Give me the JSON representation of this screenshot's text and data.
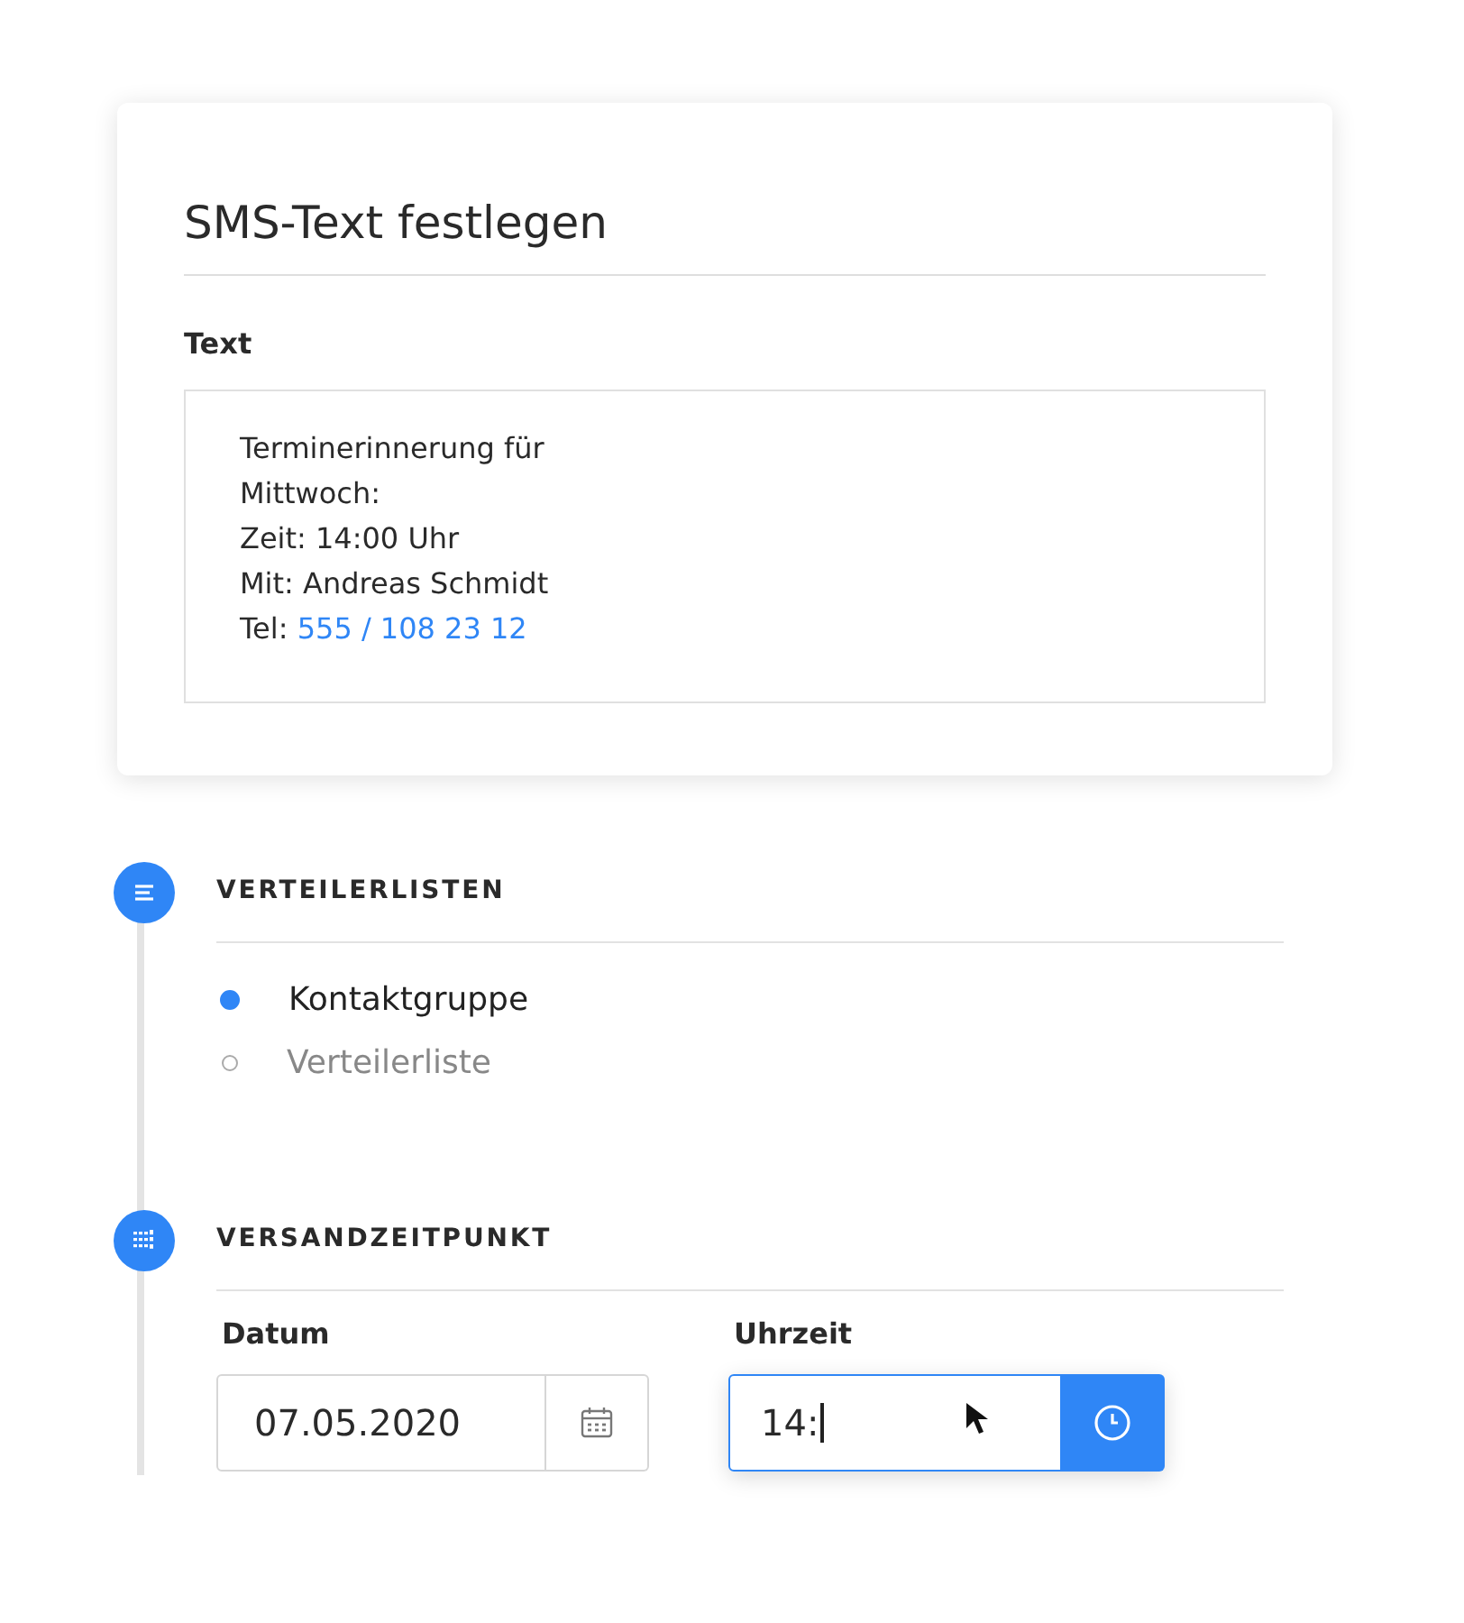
{
  "card": {
    "title": "SMS-Text festlegen",
    "field_label": "Text",
    "lines": [
      {
        "text": "Terminerinnerung für"
      },
      {
        "text": "Mittwoch:"
      },
      {
        "text": "Zeit: 14:00 Uhr"
      },
      {
        "text": "Mit: Andreas Schmidt"
      },
      {
        "text": "Tel: ",
        "link": "555 / 108 23 12"
      }
    ]
  },
  "steps": [
    {
      "kind": "list",
      "title": "VERTEILERLISTEN",
      "options": [
        {
          "label": "Kontaktgruppe",
          "selected": true
        },
        {
          "label": "Verteilerliste",
          "selected": false
        }
      ]
    },
    {
      "kind": "schedule",
      "title": "VERSANDZEITPUNKT",
      "date": {
        "label": "Datum",
        "value": "07.05.2020",
        "focused": false
      },
      "time": {
        "label": "Uhrzeit",
        "value": "14:",
        "focused": true
      }
    }
  ]
}
